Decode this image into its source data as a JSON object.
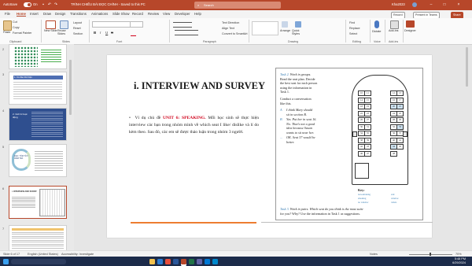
{
  "titlebar": {
    "autosave_label": "AutoSave",
    "autosave_state": "On",
    "doc_title": "TRÌNH CHIẾU BÀI ĐỌC CHÍNH - Saved to this PC",
    "search_placeholder": "Search",
    "user": "Kha2023"
  },
  "tabs": [
    "File",
    "Home",
    "Insert",
    "Draw",
    "Design",
    "Transitions",
    "Animations",
    "Slide Show",
    "Record",
    "Review",
    "View",
    "Developer",
    "Help"
  ],
  "active_tab": "Home",
  "header_buttons": {
    "record": "Record",
    "present": "Present in Teams",
    "share": "Share"
  },
  "ribbon": {
    "clipboard": {
      "paste": "Paste",
      "cut": "Cut",
      "copy": "Copy",
      "format_painter": "Format Painter",
      "group": "Clipboard"
    },
    "slides": {
      "new_slide": "New Slide",
      "reuse": "Reuse Slides",
      "layout": "Layout",
      "reset": "Reset",
      "section": "Section",
      "group": "Slides"
    },
    "font": {
      "name": "",
      "size": "",
      "group": "Font",
      "bold": "B",
      "italic": "I",
      "underline": "U",
      "strike": "S"
    },
    "paragraph": {
      "text_direction": "Text Direction",
      "align_text": "Align Text",
      "convert_smartart": "Convert to SmartArt",
      "group": "Paragraph"
    },
    "drawing": {
      "arrange": "Arrange",
      "quick_styles": "Quick Styles",
      "group": "Drawing"
    },
    "editing": {
      "find": "Find",
      "replace": "Replace",
      "select": "Select",
      "group": "Editing"
    },
    "voice": {
      "dictate": "Dictate",
      "group": "Voice"
    },
    "addins": {
      "addins": "Add-ins",
      "group": "Add-ins"
    },
    "designer": {
      "designer": "Designer"
    }
  },
  "thumbnails": {
    "numbers": [
      "2",
      "3",
      "4",
      "5",
      "6",
      "7"
    ],
    "selected": "6",
    "thumb3_title": "1. Có đáo thể hiện",
    "thumb4_title": "2. Giới & hoạt động",
    "thumb5_title": "ĐỌC: TÓM TẮT / KIỂM TRA",
    "thumb6_title": "i. INTERVIEW AND SURVEY"
  },
  "slide": {
    "title": "i. INTERVIEW AND SURVEY",
    "bullet": "•",
    "body_pre": "Ví dụ chủ đề ",
    "body_highlight": "UNIT 6: SPEAKING.",
    "body_post": " Mỗi học sinh sẽ thực hiện interview các bạn trong nhóm mình về which seat I like/ dislike và lí do kèm theo. Sau đó, các em sẽ được thảo luận trong nhóm 3 người.",
    "worksheet": {
      "task2_label": "Task 2.",
      "task2_text": [
        "Work in groups.",
        "Read the seat plan. Decide",
        "the best seat for each person",
        "using the information in",
        "Task 1."
      ],
      "conduct": [
        "Conduct a conversation",
        "like this."
      ],
      "dialog": [
        {
          "who": "A",
          "text": [
            "I think Mary should",
            "sit in section B."
          ]
        },
        {
          "who": "B",
          "text": [
            "Yes. Put her in seat 16.",
            "No. That's not a good",
            "idea because Susan",
            "wants to sit near her."
          ]
        },
        {
          "who": "...",
          "text": [
            "OK. Seat 37 would be",
            "better."
          ]
        }
      ],
      "key_label": "Key:",
      "key_items": [
        "non-smoking",
        "smoking",
        "no window",
        "exit",
        "window",
        "toilets"
      ],
      "task3_label": "Task 3.",
      "task3_text": [
        "Work in pairs. Which seat do you think is the most suite",
        "for you? Why? Use the information in Task 1 as suggestions."
      ],
      "seats": [
        "10",
        "11",
        "12",
        "13",
        "14",
        "15",
        "16",
        "17",
        "18",
        "19",
        "20",
        "21",
        "22",
        "23",
        "24",
        "25",
        "26",
        "27",
        "28",
        "29",
        "30",
        "31",
        "32",
        "33",
        "34",
        "35",
        "36",
        "37",
        "38",
        "39",
        "40",
        "41",
        "42",
        "43",
        "44",
        "45",
        "46",
        "47",
        "48"
      ]
    }
  },
  "status": {
    "slide_count": "Slide 6 of 17",
    "language": "English (United States)",
    "accessibility": "Accessibility: Investigate",
    "notes": "Notes",
    "zoom": "70%"
  },
  "taskbar": {
    "time": "5:48 PM",
    "date": "6/29/2024"
  }
}
